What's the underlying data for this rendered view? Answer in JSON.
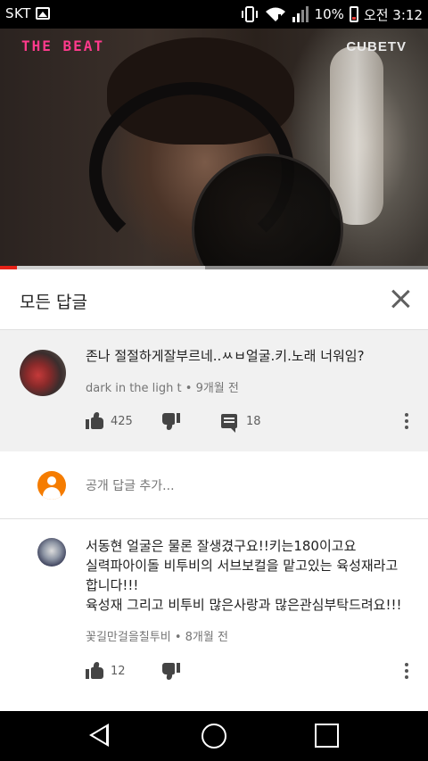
{
  "status_bar": {
    "carrier": "SKT",
    "battery": "10%",
    "time": "오전 3:12",
    "icons": [
      "gallery-icon",
      "vibrate-icon",
      "wifi-icon",
      "signal-icon",
      "battery-icon"
    ]
  },
  "video": {
    "brand_left": "THE BEAT",
    "brand_right": "CUBETV",
    "progress_fraction": 0.04,
    "buffer_fraction": 0.48
  },
  "replies_header": {
    "title": "모든 답글"
  },
  "main_comment": {
    "text": "존나 절절하게잘부르네..ㅆㅂ얼굴.키.노래 너워임?",
    "author": "dark in the ligh t",
    "age": "9개월 전",
    "likes": "425",
    "replies": "18"
  },
  "add_reply": {
    "placeholder": "공개 답글 추가..."
  },
  "reply": {
    "lines": [
      "서동현 얼굴은 물론 잘생겼구요!!키는180이고요",
      "실력파아이돌 비투비의 서브보컬을 맡고있는 육성재라고",
      "합니다!!!",
      "육성재 그리고 비투비 많은사랑과 많은관심부탁드려요!!!"
    ],
    "author": "꽃길만걸을칠투비",
    "age": "8개월 전",
    "likes": "12"
  },
  "colors": {
    "accent_red": "#e62117",
    "brand_pink": "#ff3a8c",
    "user_avatar": "#f57c00"
  }
}
